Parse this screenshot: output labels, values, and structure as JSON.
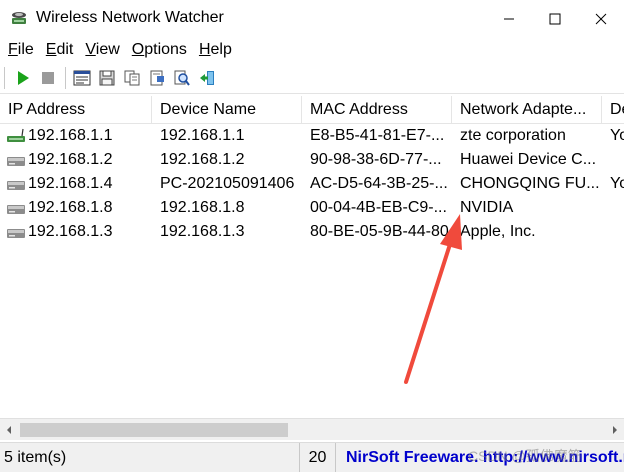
{
  "window": {
    "title": "Wireless Network Watcher",
    "minimize_icon": "minimize-icon",
    "maximize_icon": "maximize-icon",
    "close_icon": "close-icon"
  },
  "menu": [
    {
      "label": "File",
      "accel": "F",
      "rest": "ile"
    },
    {
      "label": "Edit",
      "accel": "E",
      "rest": "dit"
    },
    {
      "label": "View",
      "accel": "V",
      "rest": "iew"
    },
    {
      "label": "Options",
      "accel": "O",
      "rest": "ptions"
    },
    {
      "label": "Help",
      "accel": "H",
      "rest": "elp"
    }
  ],
  "toolbar": {
    "icons": [
      "play-icon",
      "stop-icon",
      "properties-icon",
      "save-icon",
      "copy-icon",
      "html-report-icon",
      "find-icon",
      "exit-icon"
    ]
  },
  "columns": [
    "IP Address",
    "Device Name",
    "MAC Address",
    "Network Adapte...",
    "De"
  ],
  "rows": [
    {
      "ip": "192.168.1.1",
      "name": "192.168.1.1",
      "mac": "E8-B5-41-81-E7-...",
      "adapter": "zte corporation",
      "extra": "Yo",
      "icon": "router-icon"
    },
    {
      "ip": "192.168.1.2",
      "name": "192.168.1.2",
      "mac": "90-98-38-6D-77-...",
      "adapter": "Huawei Device C...",
      "extra": "",
      "icon": "device-icon"
    },
    {
      "ip": "192.168.1.4",
      "name": "PC-202105091406",
      "mac": "AC-D5-64-3B-25-...",
      "adapter": "CHONGQING FU...",
      "extra": "Yo",
      "icon": "device-icon"
    },
    {
      "ip": "192.168.1.8",
      "name": "192.168.1.8",
      "mac": "00-04-4B-EB-C9-...",
      "adapter": "NVIDIA",
      "extra": "",
      "icon": "device-icon"
    },
    {
      "ip": "192.168.1.3",
      "name": "192.168.1.3",
      "mac": "80-BE-05-9B-44-80",
      "adapter": "Apple, Inc.",
      "extra": "",
      "icon": "device-icon"
    }
  ],
  "status": {
    "items": "5 item(s)",
    "count": "20",
    "link": "NirSoft Freeware.  http://www.nirsoft.net"
  },
  "watermark": "CSDN @孤佛魔筋",
  "colors": {
    "accent_link": "#0000cc",
    "annotation_arrow": "#f04a3c",
    "play_green": "#1aa31a"
  }
}
